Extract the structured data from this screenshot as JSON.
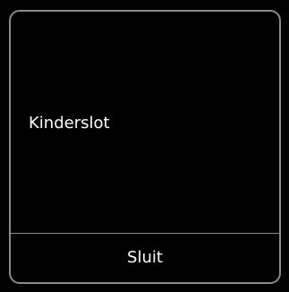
{
  "dialog": {
    "message": "Kinderslot",
    "close_label": "Sluit"
  },
  "colors": {
    "background": "#000000",
    "border": "#8a8a8a",
    "text": "#ffffff"
  }
}
